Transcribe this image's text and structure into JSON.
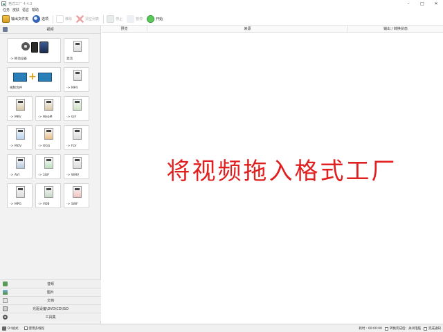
{
  "window": {
    "title": "格式工厂 4.4.3"
  },
  "menu": [
    "任务",
    "皮肤",
    "语言",
    "帮助"
  ],
  "toolbar": {
    "output_folder": "输出文件夹",
    "options": "选项",
    "remove": "移除",
    "clear_list": "清空列表",
    "stop": "停止",
    "pause": "暂停",
    "start": "开始"
  },
  "sidebar": {
    "video_category": "视频",
    "tiles": [
      {
        "label": "-> 移动设备"
      },
      {
        "label": "混流"
      },
      {
        "label": "视频合并"
      },
      {
        "label": "-> MP4"
      },
      {
        "label": "-> MKV"
      },
      {
        "label": "-> WebM"
      },
      {
        "label": "-> GIF"
      },
      {
        "label": "-> MOV"
      },
      {
        "label": "-> OGG"
      },
      {
        "label": "-> FLV"
      },
      {
        "label": "-> AVI"
      },
      {
        "label": "-> 3GP"
      },
      {
        "label": "-> WMV"
      },
      {
        "label": "-> MPG"
      },
      {
        "label": "-> VOB"
      },
      {
        "label": "-> SWF"
      }
    ],
    "bottom_categories": [
      "音频",
      "图片",
      "文档",
      "光驱设备\\DVD\\CD\\ISO",
      "工具集"
    ]
  },
  "file_list": {
    "columns": [
      "预览",
      "来源",
      "输出 / 转换状态"
    ],
    "drop_hint": "将视频拖入格式工厂"
  },
  "statusbar": {
    "left_text": "D:\\格式",
    "multithread_label": "使用多线程",
    "elapsed_label": "耗时 : 00:00:00",
    "after_convert_label": "转换完成后：关闭电脑",
    "notify_label": "完成通知"
  }
}
